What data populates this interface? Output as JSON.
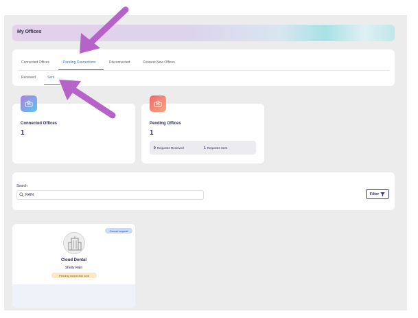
{
  "page": {
    "title": "My Offices"
  },
  "tabs": [
    {
      "label": "Connected Offices",
      "active": false
    },
    {
      "label": "Pending Connections",
      "active": true
    },
    {
      "label": "Disconnected",
      "active": false
    },
    {
      "label": "Connect New Offices",
      "active": false
    }
  ],
  "subtabs": [
    {
      "label": "Received",
      "active": false
    },
    {
      "label": "Sent",
      "active": true
    }
  ],
  "stats": {
    "connected": {
      "label": "Connected Offices",
      "value": "1",
      "icon": "office-building-icon",
      "color": "#7a7ee8"
    },
    "pending": {
      "label": "Pending Offices",
      "value": "1",
      "icon": "office-building-icon",
      "color": "#f08a6e",
      "received_count": "0",
      "received_label": "Requests Received",
      "sent_count": "1",
      "sent_label": "Requests Sent"
    }
  },
  "search": {
    "label": "Search",
    "value": "RAIN",
    "filter_label": "Filter"
  },
  "office": {
    "name": "Cloud Dental",
    "person": "Shelly Rain",
    "status": "Pending connection sent",
    "action": "Cancel request"
  },
  "colors": {
    "accent": "#3a6fd8",
    "annotation_arrow": "#b562c9"
  }
}
